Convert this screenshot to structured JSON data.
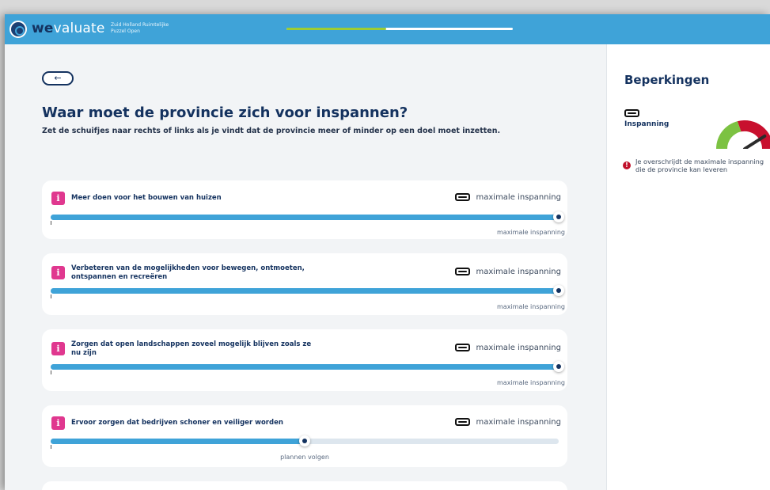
{
  "header": {
    "brand_bold": "we",
    "brand_rest": "valuate",
    "subtitle_line1": "Zuid Holland Ruimtelijke",
    "subtitle_line2": "Puzzel Open",
    "progress_fraction": 0.44,
    "colors": {
      "bar": "#3fa3d8",
      "progress": "#9ccc34"
    }
  },
  "main": {
    "back_icon": "←",
    "title": "Waar moet de provincie zich voor inspannen?",
    "subtitle": "Zet de schuifjes naar rechts of links als je vindt dat de provincie meer of minder op een doel moet inzetten.",
    "info_glyph": "i",
    "cards": [
      {
        "title_lines": [
          "Meer doen voor het bouwen van huizen"
        ],
        "cap_label": "maximale inspanning",
        "value_fraction": 1.0,
        "value_label": "maximale inspanning"
      },
      {
        "title_lines": [
          "Verbeteren van de mogelijkheden voor bewegen, ontmoeten,",
          "ontspannen en recreëren"
        ],
        "cap_label": "maximale inspanning",
        "value_fraction": 1.0,
        "value_label": "maximale inspanning"
      },
      {
        "title_lines": [
          "Zorgen dat open landschappen zoveel mogelijk blijven zoals ze",
          "nu zijn"
        ],
        "cap_label": "maximale inspanning",
        "value_fraction": 1.0,
        "value_label": "maximale inspanning"
      },
      {
        "title_lines": [
          "Ervoor zorgen dat bedrijven schoner en veiliger worden"
        ],
        "cap_label": "maximale inspanning",
        "value_fraction": 0.5,
        "value_label": "plannen volgen"
      }
    ]
  },
  "sidebar": {
    "title": "Beperkingen",
    "constraint_label": "Inspanning",
    "gauge_level": 0.82,
    "gauge_colors": [
      "#7cc242",
      "#c8102e"
    ],
    "warning_icon": "!",
    "warning_text": "Je overschrijdt de maximale inspanning die de provincie kan leveren"
  }
}
